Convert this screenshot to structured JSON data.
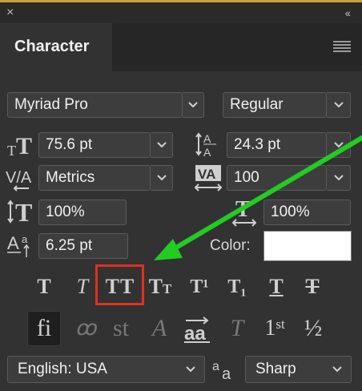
{
  "panel": {
    "tab_title": "Character",
    "close_glyph": "×",
    "collapse_glyph": "‹‹"
  },
  "font": {
    "family": "Myriad Pro",
    "style": "Regular"
  },
  "metrics": {
    "size": "75.6 pt",
    "leading": "24.3 pt",
    "kerning": "Metrics",
    "tracking": "100",
    "vertical_scale": "100%",
    "horizontal_scale": "100%",
    "baseline_shift": "6.25 pt",
    "color_label": "Color:"
  },
  "type_buttons": [
    {
      "name": "faux-bold",
      "glyph": "T"
    },
    {
      "name": "faux-italic",
      "glyph": "T"
    },
    {
      "name": "all-caps",
      "glyph": "TT"
    },
    {
      "name": "small-caps",
      "glyph": "TT"
    },
    {
      "name": "superscript",
      "glyph": "T¹"
    },
    {
      "name": "subscript",
      "glyph": "T₁"
    },
    {
      "name": "underline",
      "glyph": "T"
    },
    {
      "name": "strikethrough",
      "glyph": "T"
    }
  ],
  "opentype_buttons": [
    {
      "name": "ligatures",
      "glyph": "fi"
    },
    {
      "name": "discretionary-ligatures",
      "glyph": "ꝏ"
    },
    {
      "name": "contextual-alternates",
      "glyph": "st"
    },
    {
      "name": "swash",
      "glyph": "A"
    },
    {
      "name": "stylistic-alternates",
      "glyph": "aa"
    },
    {
      "name": "titling-alternates",
      "glyph": "T"
    },
    {
      "name": "ordinals",
      "glyph": "1st"
    },
    {
      "name": "fractions",
      "glyph": "½"
    }
  ],
  "language": "English: USA",
  "antialias": {
    "icon": "aa",
    "value": "Sharp"
  },
  "colors": {
    "arrow": "#22cc22",
    "highlight": "#e0301e",
    "swatch": "#ffffff"
  }
}
